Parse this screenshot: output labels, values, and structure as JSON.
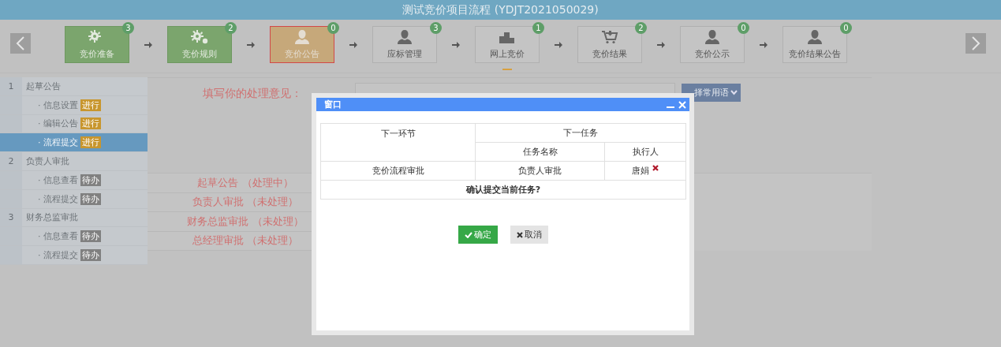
{
  "window": {
    "title": "测试竞价项目流程 (YDJT2021050029)"
  },
  "steps": [
    {
      "label": "竞价准备",
      "count": "3",
      "kind": "done",
      "selected": false
    },
    {
      "label": "竞价规则",
      "count": "2",
      "kind": "done",
      "selected": false
    },
    {
      "label": "竞价公告",
      "count": "0",
      "kind": "current",
      "selected": false
    },
    {
      "label": "应标管理",
      "count": "3",
      "kind": "todo",
      "selected": false
    },
    {
      "label": "网上竞价",
      "count": "1",
      "kind": "todo",
      "selected": true
    },
    {
      "label": "竞价结果",
      "count": "2",
      "kind": "todo",
      "selected": false
    },
    {
      "label": "竞价公示",
      "count": "0",
      "kind": "todo",
      "selected": false
    },
    {
      "label": "竞价结果公告",
      "count": "0",
      "kind": "todo",
      "selected": false
    }
  ],
  "sidebar": {
    "items": [
      {
        "number": "1",
        "label": "起草公告",
        "children": [
          {
            "label": "· 信息设置",
            "tag": "进行",
            "kind": "active",
            "selected": false
          },
          {
            "label": "· 编辑公告",
            "tag": "进行",
            "kind": "active",
            "selected": false
          },
          {
            "label": "· 流程提交",
            "tag": "进行",
            "kind": "active",
            "selected": true
          }
        ]
      },
      {
        "number": "2",
        "label": "负责人审批",
        "children": [
          {
            "label": "· 信息查看",
            "tag": "待办",
            "kind": "pending",
            "selected": false
          },
          {
            "label": "· 流程提交",
            "tag": "待办",
            "kind": "pending",
            "selected": false
          }
        ]
      },
      {
        "number": "3",
        "label": "财务总监审批",
        "children": [
          {
            "label": "· 信息查看",
            "tag": "待办",
            "kind": "pending",
            "selected": false
          },
          {
            "label": "· 流程提交",
            "tag": "待办",
            "kind": "pending",
            "selected": false
          }
        ]
      }
    ]
  },
  "opinion": {
    "label": "填写你的处理意见：",
    "phrase_button": "择常用语"
  },
  "progress": [
    "起草公告 （处理中）",
    "负责人审批 （未处理）",
    "财务总监审批 （未处理）",
    "总经理审批 （未处理）"
  ],
  "dialog": {
    "title": "窗口",
    "table": {
      "header_1": "下一环节",
      "header_2": "下一任务",
      "subheaders": [
        "任务名称",
        "执行人"
      ],
      "rows": [
        {
          "step": "竞价流程审批",
          "task": "负责人审批",
          "assignee": "唐娟"
        }
      ],
      "confirm": "确认提交当前任务?"
    },
    "buttons": [
      {
        "label": "确定",
        "kind": "ok"
      },
      {
        "label": "取消",
        "kind": "cancel"
      }
    ]
  }
}
